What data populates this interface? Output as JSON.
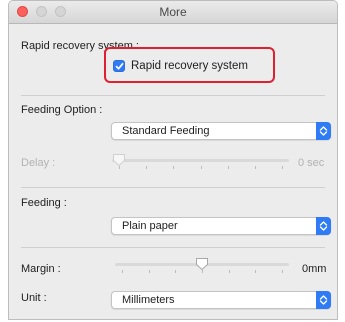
{
  "window": {
    "title": "More"
  },
  "rapid_recovery": {
    "section_label": "Rapid recovery system :",
    "checkbox_label": "Rapid recovery system",
    "checked": true
  },
  "feeding_option": {
    "label": "Feeding Option :",
    "value": "Standard Feeding"
  },
  "delay": {
    "label": "Delay :",
    "value_text": "0 sec",
    "level": 0,
    "enabled": false
  },
  "feeding": {
    "label": "Feeding :",
    "value": "Plain paper"
  },
  "margin": {
    "label": "Margin :",
    "value_text": "0mm",
    "level": 0.5
  },
  "unit": {
    "label": "Unit :",
    "value": "Millimeters"
  },
  "colors": {
    "accent": "#2f7bf5",
    "highlight": "#e02030"
  }
}
